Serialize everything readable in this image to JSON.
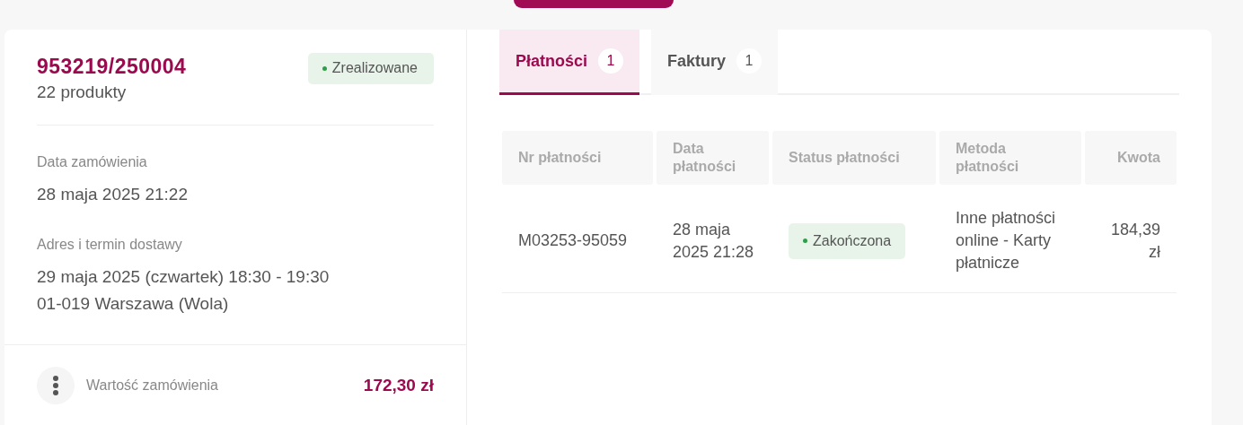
{
  "order": {
    "number": "953219/250004",
    "products": "22 produkty",
    "status": "Zrealizowane",
    "fields": [
      {
        "label": "Data zamówienia",
        "lines": [
          "28 maja 2025 21:22"
        ]
      },
      {
        "label": "Adres i termin dostawy",
        "lines": [
          "29 maja 2025 (czwartek) 18:30 - 19:30",
          "01-019 Warszawa (Wola)"
        ]
      }
    ],
    "total": {
      "label": "Wartość zamówienia",
      "value": "172,30 zł"
    }
  },
  "tabs": [
    {
      "label": "Płatności",
      "count": "1",
      "selected": true
    },
    {
      "label": "Faktury",
      "count": "1",
      "selected": false
    }
  ],
  "table": {
    "columns": [
      "Nr płatności",
      "Data płatności",
      "Status płatności",
      "Metoda płatności",
      "Kwota"
    ],
    "rows": [
      {
        "cells": [
          {
            "kind": "text",
            "text": "M03253-95059"
          },
          {
            "kind": "text",
            "text": "28 maja 2025 21:28"
          },
          {
            "kind": "badge",
            "text": "Zakończona"
          },
          {
            "kind": "text",
            "text": "Inne płatności online - Karty płatnicze"
          },
          {
            "kind": "text",
            "text": "184,39 zł"
          }
        ]
      }
    ]
  }
}
